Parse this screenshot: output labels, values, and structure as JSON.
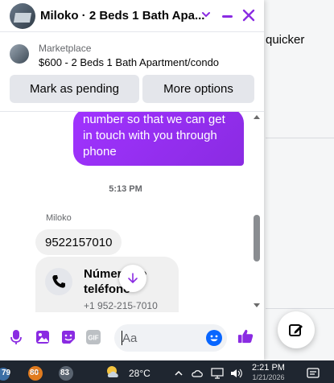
{
  "chat": {
    "title": "Miloko · 2 Beds 1 Bath Apa...",
    "marketplace_label": "Marketplace",
    "listing": "$600 - 2 Beds 1 Bath Apartment/condo",
    "mark_pending_label": "Mark as pending",
    "more_options_label": "More options",
    "outgoing_message": "number so that we can get in touch with you through phone",
    "timestamp": "5:13 PM",
    "sender_name": "Miloko",
    "incoming_message": "9522157010",
    "contact_card": {
      "title": "Número de teléfono",
      "phone": "+1 952-215-7010"
    },
    "composer_placeholder": "Aa",
    "accent_color": "#8a2be2"
  },
  "background": {
    "partial_text": "quicker"
  },
  "taskbar": {
    "badges": [
      "79",
      "80",
      "83"
    ],
    "temperature": "28°C",
    "time": "2:21 PM",
    "date": "1/21/2026"
  }
}
